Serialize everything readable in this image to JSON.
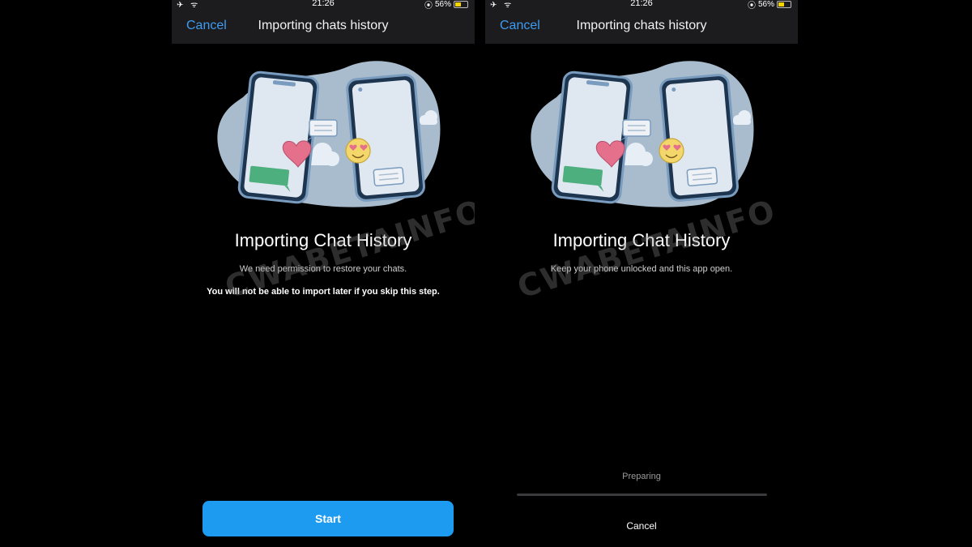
{
  "status_bar": {
    "time": "21:26",
    "battery_percent": "56%",
    "battery_level": 0.56,
    "left_icons": "✈ ᯤ",
    "alarm_icon": "⦿"
  },
  "screens": [
    {
      "nav": {
        "cancel_label": "Cancel",
        "title": "Importing chats history"
      },
      "heading": "Importing Chat History",
      "subtext": "We need permission to restore your chats.",
      "warning": "You will not be able to import later if you skip this step.",
      "start_label": "Start",
      "watermark": "CWABETAINFO"
    },
    {
      "nav": {
        "cancel_label": "Cancel",
        "title": "Importing chats history"
      },
      "heading": "Importing Chat History",
      "subtext": "Keep your phone unlocked and this app open.",
      "progress_label": "Preparing",
      "progress_value": 0,
      "bottom_cancel_label": "Cancel",
      "watermark": "CWABETAINFO"
    }
  ],
  "colors": {
    "accent": "#3e9bf1",
    "button": "#1d9bf0",
    "blob": "#a9bccd",
    "phone_outline": "#7a9cbe",
    "green_bubble": "#4caf7d",
    "heart": "#e5708c",
    "emoji": "#f4d76b"
  }
}
